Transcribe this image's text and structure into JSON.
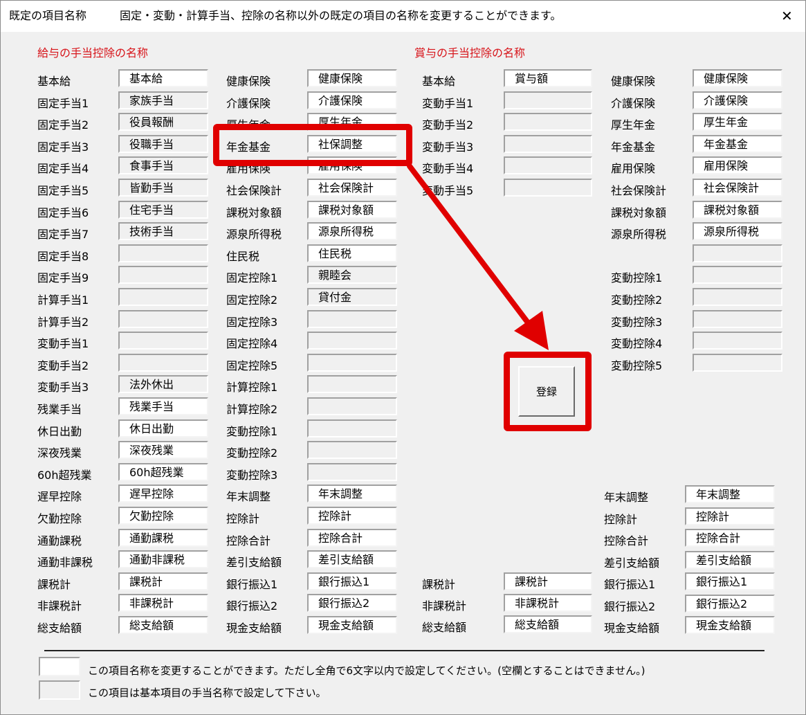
{
  "title": {
    "window_title": "既定の項目名称",
    "description": "固定・変動・計算手当、控除の名称以外の既定の項目の名称を変更することができます。",
    "close_label": "✕"
  },
  "sections": {
    "salary": "給与の手当控除の名称",
    "bonus": "賞与の手当控除の名称"
  },
  "salary_allowances": [
    {
      "label": "基本給",
      "value": "基本給",
      "editable": true
    },
    {
      "label": "固定手当1",
      "value": "家族手当",
      "editable": false
    },
    {
      "label": "固定手当2",
      "value": "役員報酬",
      "editable": false
    },
    {
      "label": "固定手当3",
      "value": "役職手当",
      "editable": false
    },
    {
      "label": "固定手当4",
      "value": "食事手当",
      "editable": false
    },
    {
      "label": "固定手当5",
      "value": "皆勤手当",
      "editable": false
    },
    {
      "label": "固定手当6",
      "value": "住宅手当",
      "editable": false
    },
    {
      "label": "固定手当7",
      "value": "技術手当",
      "editable": false
    },
    {
      "label": "固定手当8",
      "value": "",
      "editable": false
    },
    {
      "label": "固定手当9",
      "value": "",
      "editable": false
    },
    {
      "label": "計算手当1",
      "value": "",
      "editable": false
    },
    {
      "label": "計算手当2",
      "value": "",
      "editable": false
    },
    {
      "label": "変動手当1",
      "value": "",
      "editable": false
    },
    {
      "label": "変動手当2",
      "value": "",
      "editable": false
    },
    {
      "label": "変動手当3",
      "value": "法外休出",
      "editable": false
    },
    {
      "label": "残業手当",
      "value": "残業手当",
      "editable": true
    },
    {
      "label": "休日出勤",
      "value": "休日出勤",
      "editable": true
    },
    {
      "label": "深夜残業",
      "value": "深夜残業",
      "editable": true
    },
    {
      "label": "60h超残業",
      "value": "60h超残業",
      "editable": true
    },
    {
      "label": "遅早控除",
      "value": "遅早控除",
      "editable": true
    },
    {
      "label": "欠勤控除",
      "value": "欠勤控除",
      "editable": true
    },
    {
      "label": "通勤課税",
      "value": "通勤課税",
      "editable": true
    },
    {
      "label": "通勤非課税",
      "value": "通勤非課税",
      "editable": true
    },
    {
      "label": "課税計",
      "value": "課税計",
      "editable": true
    },
    {
      "label": "非課税計",
      "value": "非課税計",
      "editable": true
    },
    {
      "label": "総支給額",
      "value": "総支給額",
      "editable": true
    }
  ],
  "salary_deductions": [
    {
      "label": "健康保険",
      "value": "健康保険",
      "editable": true
    },
    {
      "label": "介護保険",
      "value": "介護保険",
      "editable": true
    },
    {
      "label": "厚生年金",
      "value": "厚生年金",
      "editable": true
    },
    {
      "label": "年金基金",
      "value": "社保調整",
      "editable": true
    },
    {
      "label": "雇用保険",
      "value": "雇用保険",
      "editable": true
    },
    {
      "label": "社会保険計",
      "value": "社会保険計",
      "editable": true
    },
    {
      "label": "課税対象額",
      "value": "課税対象額",
      "editable": true
    },
    {
      "label": "源泉所得税",
      "value": "源泉所得税",
      "editable": true
    },
    {
      "label": "住民税",
      "value": "住民税",
      "editable": true
    },
    {
      "label": "固定控除1",
      "value": "親睦会",
      "editable": false
    },
    {
      "label": "固定控除2",
      "value": "貸付金",
      "editable": false
    },
    {
      "label": "固定控除3",
      "value": "",
      "editable": false
    },
    {
      "label": "固定控除4",
      "value": "",
      "editable": false
    },
    {
      "label": "固定控除5",
      "value": "",
      "editable": false
    },
    {
      "label": "計算控除1",
      "value": "",
      "editable": false
    },
    {
      "label": "計算控除2",
      "value": "",
      "editable": false
    },
    {
      "label": "変動控除1",
      "value": "",
      "editable": false
    },
    {
      "label": "変動控除2",
      "value": "",
      "editable": false
    },
    {
      "label": "変動控除3",
      "value": "",
      "editable": false
    },
    {
      "label": "年末調整",
      "value": "年末調整",
      "editable": true
    },
    {
      "label": "控除計",
      "value": "控除計",
      "editable": true
    },
    {
      "label": "控除合計",
      "value": "控除合計",
      "editable": true
    },
    {
      "label": "差引支給額",
      "value": "差引支給額",
      "editable": true
    },
    {
      "label": "銀行振込1",
      "value": "銀行振込1",
      "editable": true
    },
    {
      "label": "銀行振込2",
      "value": "銀行振込2",
      "editable": true
    },
    {
      "label": "現金支給額",
      "value": "現金支給額",
      "editable": true
    }
  ],
  "bonus_allowances_top": [
    {
      "label": "基本給",
      "value": "賞与額",
      "editable": true
    },
    {
      "label": "変動手当1",
      "value": "",
      "editable": false
    },
    {
      "label": "変動手当2",
      "value": "",
      "editable": false
    },
    {
      "label": "変動手当3",
      "value": "",
      "editable": false
    },
    {
      "label": "変動手当4",
      "value": "",
      "editable": false
    },
    {
      "label": "変動手当5",
      "value": "",
      "editable": false
    }
  ],
  "bonus_allowances_bottom": [
    {
      "label": "課税計",
      "value": "課税計",
      "editable": true
    },
    {
      "label": "非課税計",
      "value": "非課税計",
      "editable": true
    },
    {
      "label": "総支給額",
      "value": "総支給額",
      "editable": true
    }
  ],
  "bonus_deductions_top": [
    {
      "label": "健康保険",
      "value": "健康保険",
      "editable": true
    },
    {
      "label": "介護保険",
      "value": "介護保険",
      "editable": true
    },
    {
      "label": "厚生年金",
      "value": "厚生年金",
      "editable": true
    },
    {
      "label": "年金基金",
      "value": "年金基金",
      "editable": true
    },
    {
      "label": "雇用保険",
      "value": "雇用保険",
      "editable": true
    },
    {
      "label": "社会保険計",
      "value": "社会保険計",
      "editable": true
    },
    {
      "label": "課税対象額",
      "value": "課税対象額",
      "editable": true
    },
    {
      "label": "源泉所得税",
      "value": "源泉所得税",
      "editable": true
    },
    {
      "label": "",
      "value": "",
      "editable": false
    },
    {
      "label": "変動控除1",
      "value": "",
      "editable": false
    },
    {
      "label": "変動控除2",
      "value": "",
      "editable": false
    },
    {
      "label": "変動控除3",
      "value": "",
      "editable": false
    },
    {
      "label": "変動控除4",
      "value": "",
      "editable": false
    },
    {
      "label": "変動控除5",
      "value": "",
      "editable": false
    }
  ],
  "bonus_deductions_bottom": [
    {
      "label": "年末調整",
      "value": "年末調整",
      "editable": true
    },
    {
      "label": "控除計",
      "value": "控除計",
      "editable": true
    },
    {
      "label": "控除合計",
      "value": "控除合計",
      "editable": true
    },
    {
      "label": "差引支給額",
      "value": "差引支給額",
      "editable": true
    },
    {
      "label": "銀行振込1",
      "value": "銀行振込1",
      "editable": true
    },
    {
      "label": "銀行振込2",
      "value": "銀行振込2",
      "editable": true
    },
    {
      "label": "現金支給額",
      "value": "現金支給額",
      "editable": true
    }
  ],
  "register_label": "登録",
  "legend": {
    "editable_text": "この項目名称を変更することができます。ただし全角で6文字以内で設定してください。(空欄とすることはできません。)",
    "fixed_text": "この項目は基本項目の手当名称で設定して下さい。"
  },
  "colors": {
    "highlight": "#e00000",
    "section_title": "#d7141a",
    "window_bg": "#f0f0f0"
  }
}
